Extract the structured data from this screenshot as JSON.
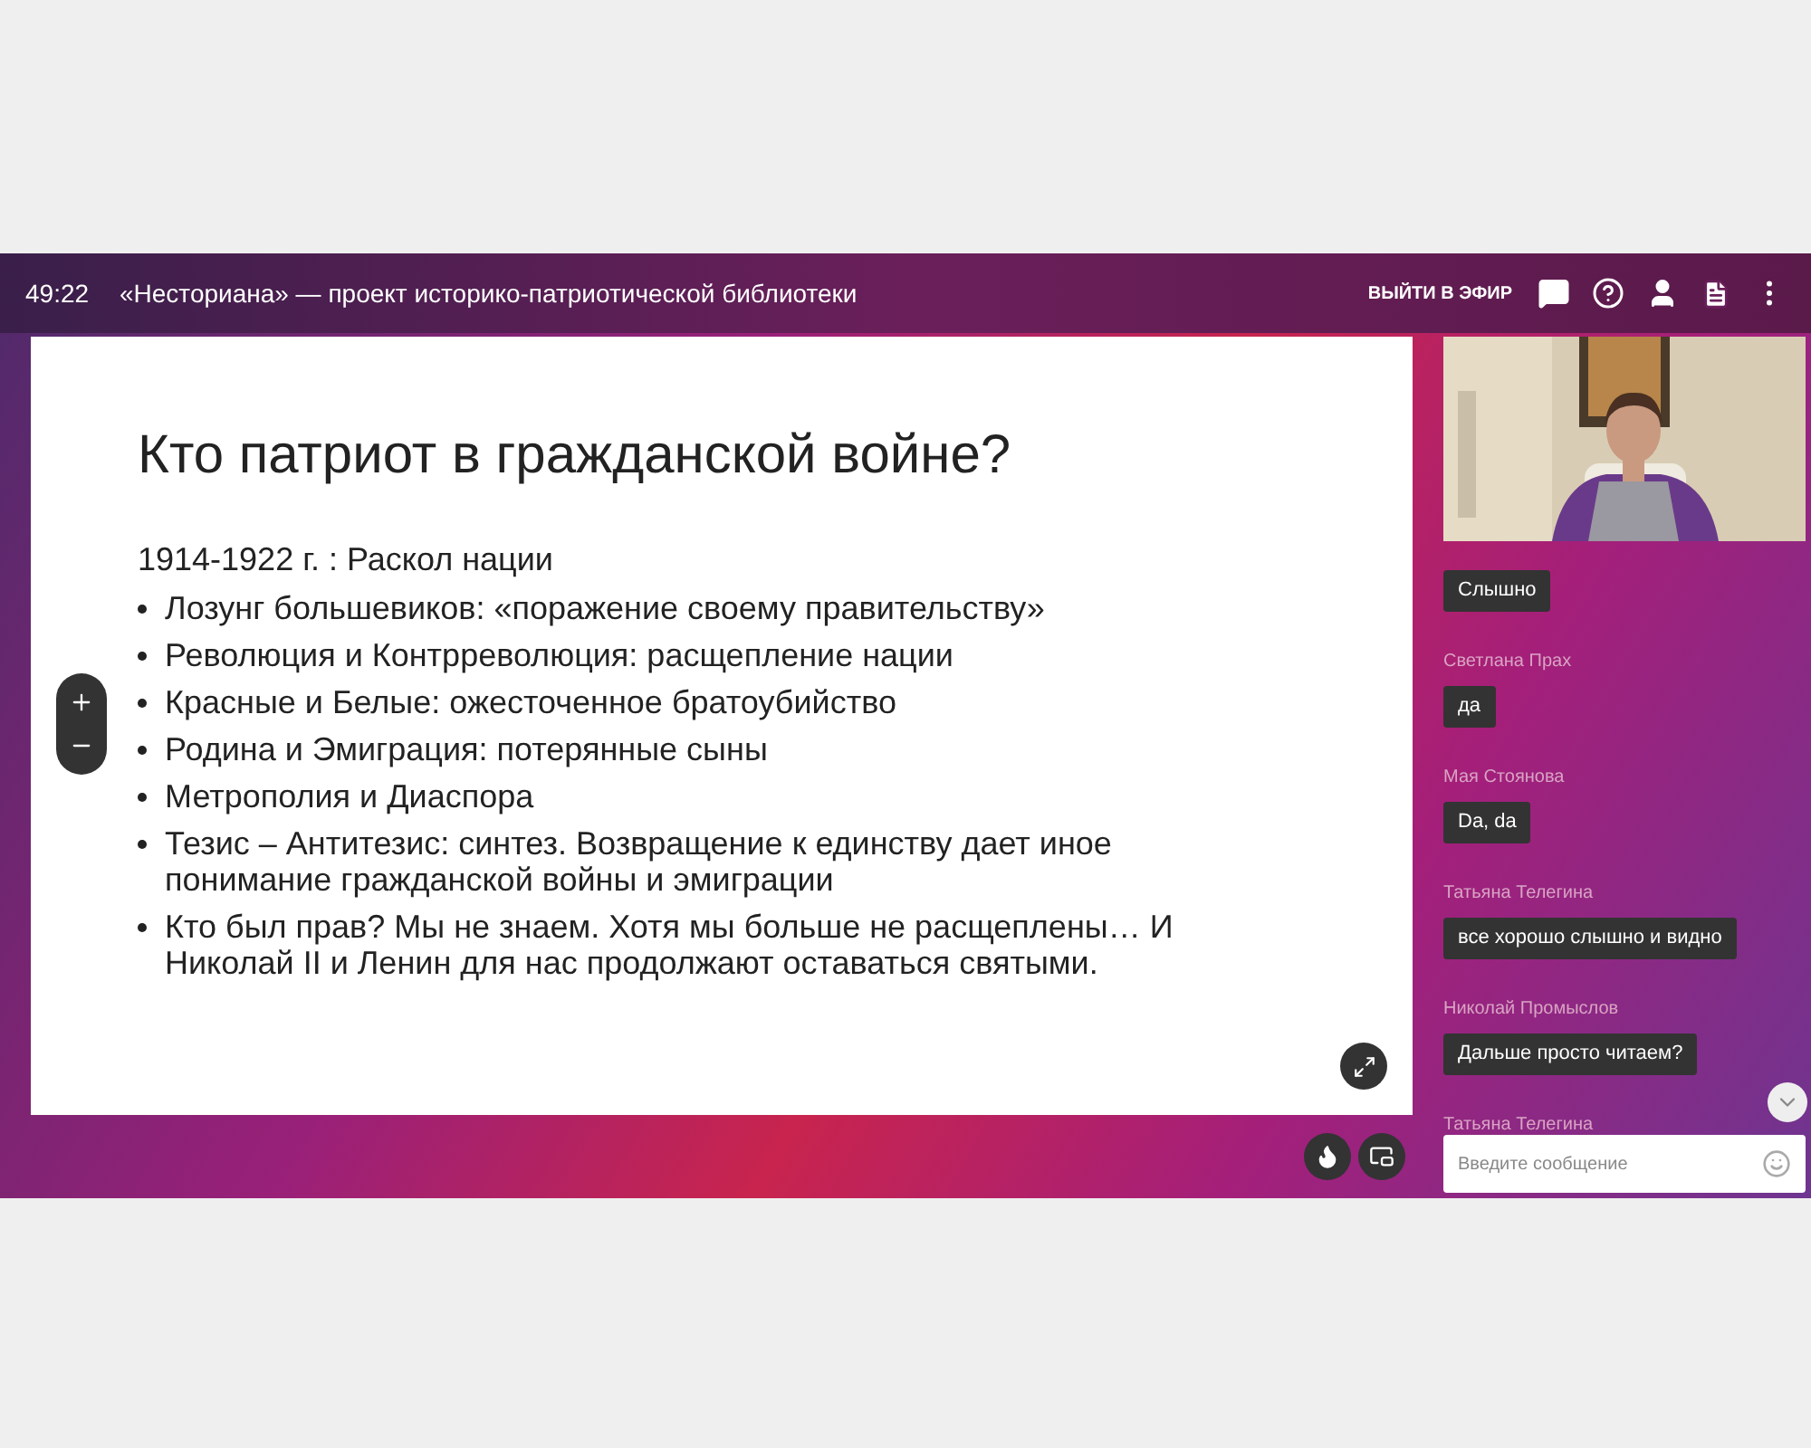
{
  "top_bar": {
    "timer": "49:22",
    "title": "«Несториана» — проект историко-патриотической библиотеки",
    "go_live_button": "ВЫЙТИ В ЭФИР"
  },
  "slide": {
    "title": "Кто патриот в гражданской войне?",
    "subtitle": "1914-1922 г. : Раскол нации",
    "bullets": [
      "Лозунг большевиков: «поражение своему правительству»",
      "Революция и Контрреволюция: расщепление нации",
      "Красные и Белые: ожесточенное братоубийство",
      "Родина и Эмиграция: потерянные сыны",
      "Метрополия и Диаспора",
      "Тезис – Антитезис: синтез. Возвращение к единству дает иное понимание гражданской войны и эмиграции",
      "Кто был прав? Мы не знаем. Хотя мы больше не расщеплены… И Николай II  и Ленин для нас продолжают оставаться святыми."
    ]
  },
  "chat": {
    "items": [
      {
        "kind": "message",
        "text": "Слышно"
      },
      {
        "kind": "author",
        "text": "Светлана Прах"
      },
      {
        "kind": "message",
        "text": "да"
      },
      {
        "kind": "author",
        "text": "Мая Стоянова"
      },
      {
        "kind": "message",
        "text": "Da, da"
      },
      {
        "kind": "author",
        "text": "Татьяна Телегина"
      },
      {
        "kind": "message",
        "text": "все хорошо слышно и видно"
      },
      {
        "kind": "author",
        "text": "Николай Промыслов"
      },
      {
        "kind": "message",
        "text": "Дальше просто читаем?"
      },
      {
        "kind": "author",
        "text": "Татьяна Телегина"
      }
    ],
    "input": {
      "placeholder": "Введите сообщение"
    }
  }
}
